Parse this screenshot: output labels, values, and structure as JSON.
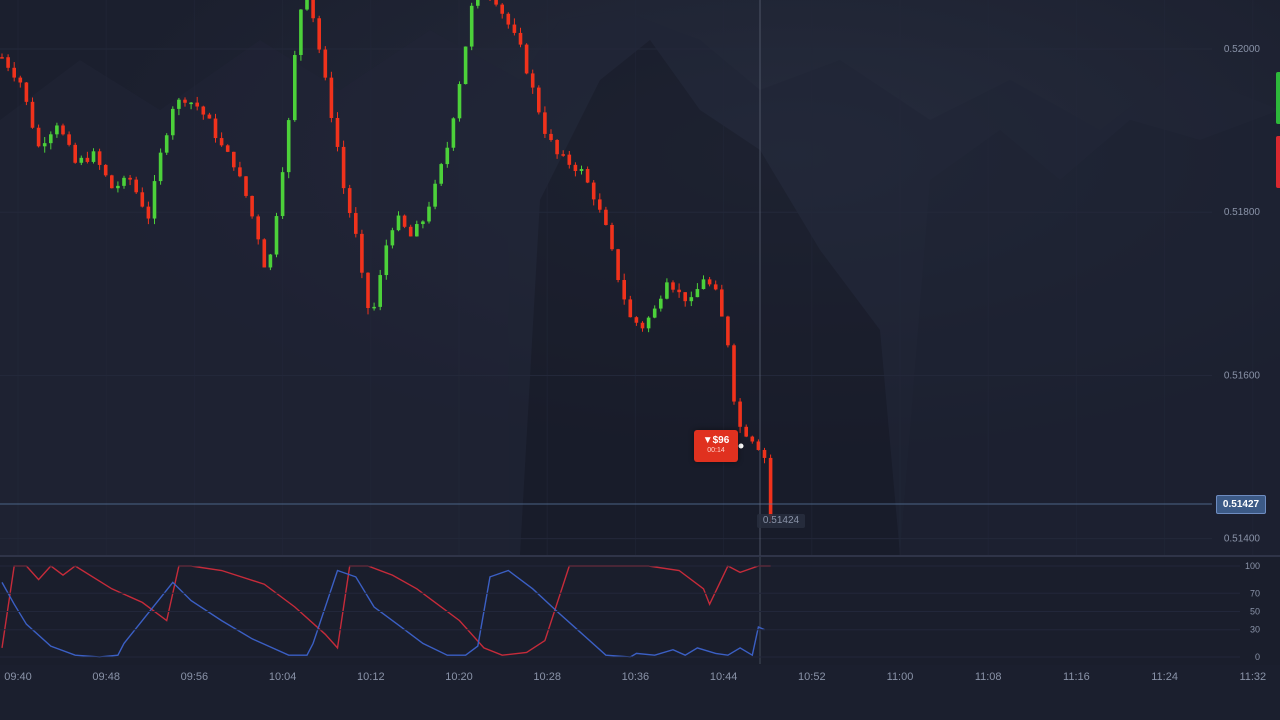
{
  "chart_data": {
    "type": "candlestick",
    "x_ticks": [
      "09:40",
      "09:48",
      "09:56",
      "10:04",
      "10:12",
      "10:20",
      "10:28",
      "10:36",
      "10:44",
      "10:52",
      "11:00",
      "11:08",
      "11:16",
      "11:24",
      "11:32"
    ],
    "y_ticks": [
      "0.52000",
      "0.51800",
      "0.51600",
      "0.51400"
    ],
    "ylim": [
      0.5138,
      0.5206
    ],
    "current_price": "0.51427",
    "cursor_price": "0.51424",
    "close_path": [
      [
        0,
        0.5199
      ],
      [
        3,
        0.5196
      ],
      [
        6,
        0.5188
      ],
      [
        9,
        0.5191
      ],
      [
        12,
        0.5186
      ],
      [
        15,
        0.5187
      ],
      [
        18,
        0.5183
      ],
      [
        21,
        0.5184
      ],
      [
        24,
        0.51795
      ],
      [
        26,
        0.5187
      ],
      [
        28,
        0.5193
      ],
      [
        30,
        0.5194
      ],
      [
        32,
        0.5193
      ],
      [
        34,
        0.5191
      ],
      [
        36,
        0.5188
      ],
      [
        38,
        0.5186
      ],
      [
        40,
        0.5182
      ],
      [
        42,
        0.5177
      ],
      [
        43.5,
        0.5172
      ],
      [
        45,
        0.518
      ],
      [
        47,
        0.5191
      ],
      [
        48,
        0.5199
      ],
      [
        49,
        0.5205
      ],
      [
        49.5,
        0.5208
      ],
      [
        51,
        0.5204
      ],
      [
        53,
        0.5196
      ],
      [
        55,
        0.5188
      ],
      [
        56,
        0.5183
      ],
      [
        58,
        0.5177
      ],
      [
        59,
        0.5172
      ],
      [
        60.5,
        0.51665
      ],
      [
        62,
        0.5172
      ],
      [
        63.5,
        0.5178
      ],
      [
        65,
        0.5179
      ],
      [
        67,
        0.5177
      ],
      [
        69,
        0.5179
      ],
      [
        71,
        0.5183
      ],
      [
        73,
        0.5188
      ],
      [
        75,
        0.5196
      ],
      [
        77,
        0.5205
      ],
      [
        79,
        0.5208
      ],
      [
        81,
        0.5206
      ],
      [
        83,
        0.5203
      ],
      [
        85,
        0.52
      ],
      [
        87,
        0.5195
      ],
      [
        89,
        0.519
      ],
      [
        91,
        0.5187
      ],
      [
        93,
        0.5186
      ],
      [
        95,
        0.5185
      ],
      [
        97,
        0.5182
      ],
      [
        99,
        0.5178
      ],
      [
        101,
        0.5172
      ],
      [
        103,
        0.5167
      ],
      [
        105,
        0.5166
      ],
      [
        107,
        0.5168
      ],
      [
        109,
        0.5172
      ],
      [
        111,
        0.517
      ],
      [
        113,
        0.5169
      ],
      [
        115,
        0.5172
      ],
      [
        117,
        0.517
      ],
      [
        119,
        0.5164
      ],
      [
        120.5,
        0.5154
      ],
      [
        122,
        0.5153
      ],
      [
        123.5,
        0.5152
      ],
      [
        125,
        0.515
      ],
      [
        126,
        0.51427
      ]
    ],
    "oscillator": {
      "y_ticks": [
        "100",
        "70",
        "50",
        "30",
        "0"
      ],
      "ylim": [
        0,
        100
      ],
      "series": [
        {
          "color": "#c62b3a",
          "points": [
            [
              0,
              10
            ],
            [
              2,
              100
            ],
            [
              4,
              100
            ],
            [
              6,
              85
            ],
            [
              8,
              100
            ],
            [
              10,
              90
            ],
            [
              12,
              100
            ],
            [
              18,
              75
            ],
            [
              23,
              60
            ],
            [
              27,
              40
            ],
            [
              29,
              100
            ],
            [
              31,
              100
            ],
            [
              36,
              95
            ],
            [
              43,
              80
            ],
            [
              48,
              55
            ],
            [
              53,
              25
            ],
            [
              55,
              10
            ],
            [
              57,
              100
            ],
            [
              60,
              100
            ],
            [
              64,
              90
            ],
            [
              68,
              75
            ],
            [
              71,
              60
            ],
            [
              75,
              40
            ],
            [
              79,
              10
            ],
            [
              82,
              2
            ],
            [
              86,
              5
            ],
            [
              89,
              18
            ],
            [
              93,
              100
            ],
            [
              98,
              100
            ],
            [
              102,
              100
            ],
            [
              106,
              100
            ],
            [
              111,
              95
            ],
            [
              115,
              75
            ],
            [
              116,
              58
            ],
            [
              119,
              100
            ],
            [
              121,
              93
            ],
            [
              124,
              100
            ],
            [
              126,
              100
            ]
          ]
        },
        {
          "color": "#3b5fc4",
          "points": [
            [
              0,
              82
            ],
            [
              2,
              58
            ],
            [
              4,
              36
            ],
            [
              8,
              12
            ],
            [
              12,
              2
            ],
            [
              16,
              0
            ],
            [
              19,
              2
            ],
            [
              20,
              15
            ],
            [
              28,
              82
            ],
            [
              31,
              62
            ],
            [
              36,
              40
            ],
            [
              41,
              20
            ],
            [
              47,
              2
            ],
            [
              50,
              2
            ],
            [
              51,
              15
            ],
            [
              55,
              95
            ],
            [
              58,
              88
            ],
            [
              61,
              55
            ],
            [
              65,
              35
            ],
            [
              69,
              15
            ],
            [
              73,
              2
            ],
            [
              76,
              2
            ],
            [
              78,
              12
            ],
            [
              80,
              88
            ],
            [
              83,
              95
            ],
            [
              87,
              75
            ],
            [
              91,
              50
            ],
            [
              95,
              26
            ],
            [
              99,
              2
            ],
            [
              103,
              0
            ],
            [
              104,
              4
            ],
            [
              107,
              2
            ],
            [
              110,
              8
            ],
            [
              112,
              2
            ],
            [
              114,
              10
            ],
            [
              117,
              4
            ],
            [
              119,
              2
            ],
            [
              121,
              10
            ],
            [
              123,
              2
            ],
            [
              124,
              33
            ],
            [
              125,
              30
            ]
          ]
        }
      ]
    }
  },
  "trade_tooltip": {
    "amount": "▼$96",
    "time": "00:14"
  },
  "colors": {
    "bull": "#4cd13a",
    "bear": "#f0321c",
    "background": "#1b1f2e",
    "grid": "#23283a"
  }
}
